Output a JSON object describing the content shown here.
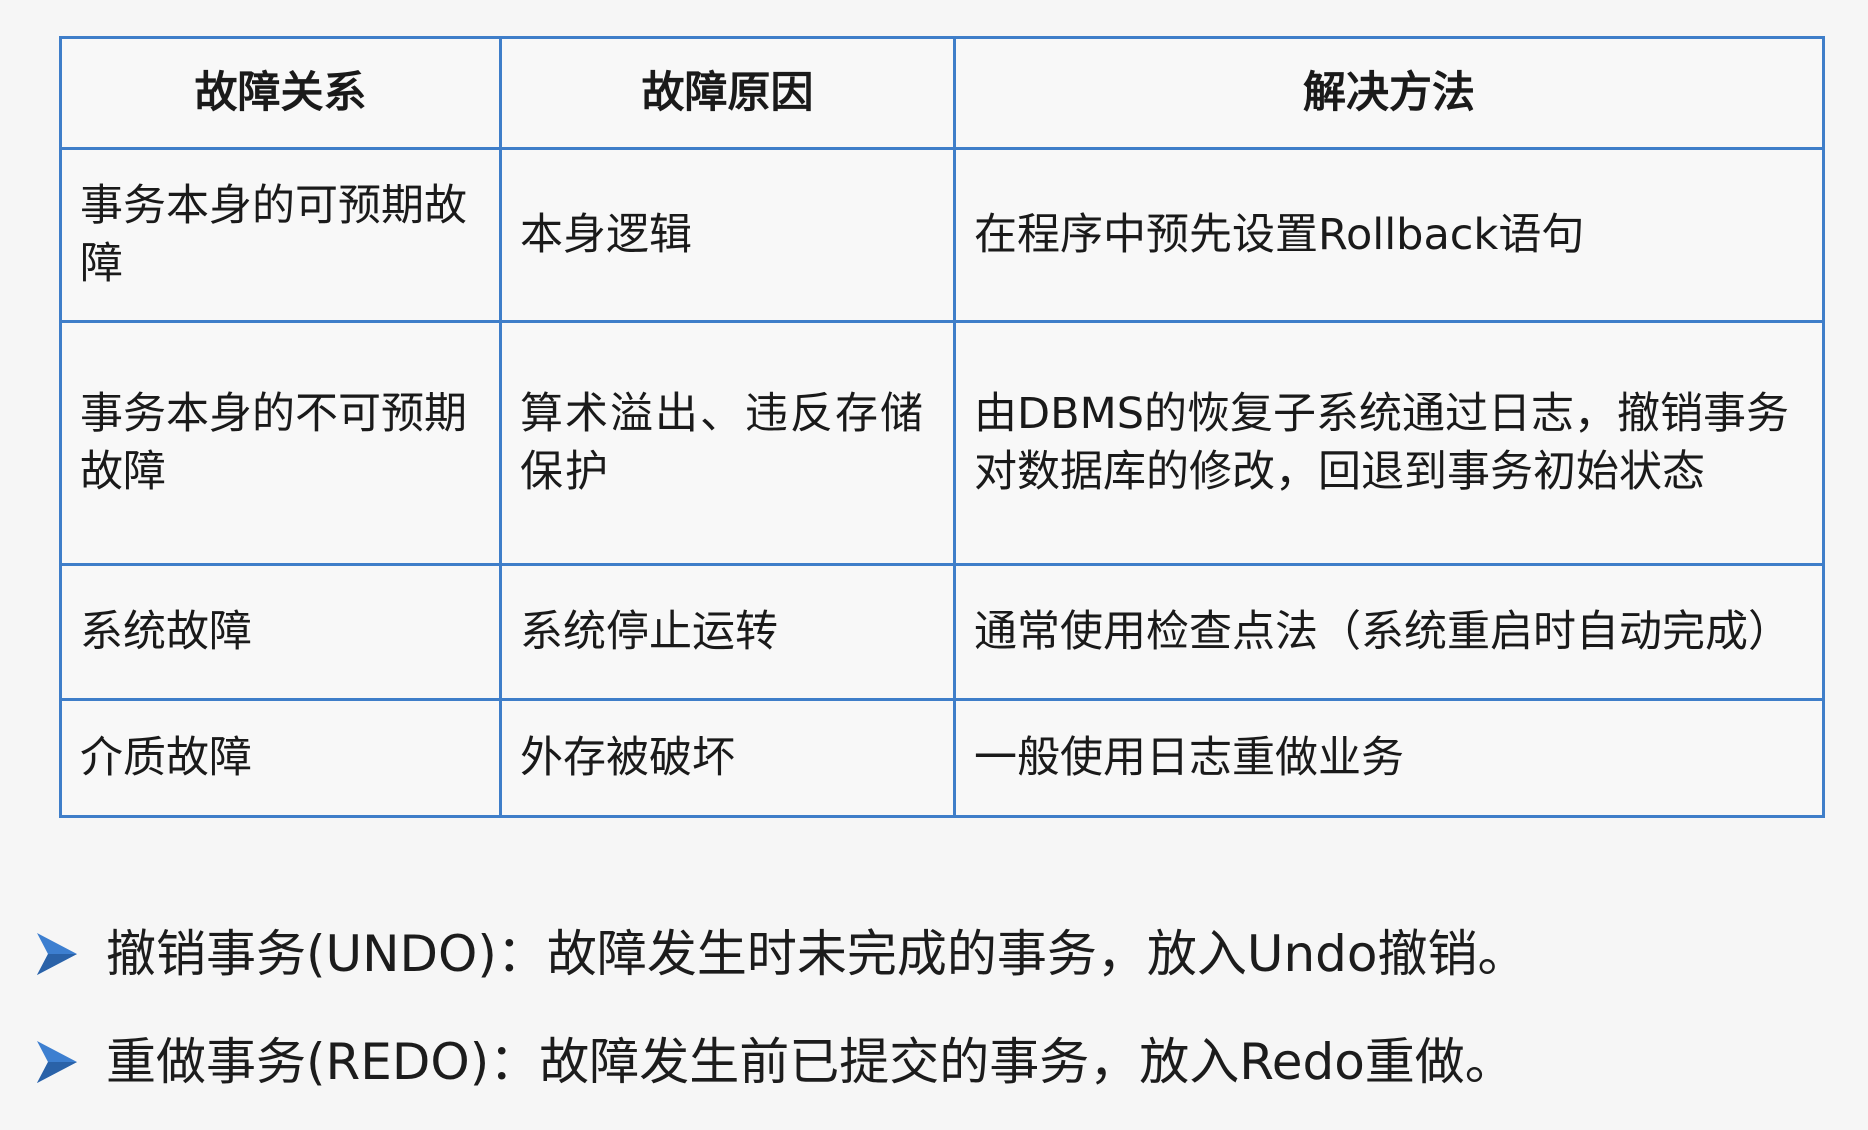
{
  "table": {
    "headers": [
      "故障关系",
      "故障原因",
      "解决方法"
    ],
    "rows": [
      {
        "relation": "事务本身的可预期故障",
        "cause": "本身逻辑",
        "solution": "在程序中预先设置Rollback语句"
      },
      {
        "relation": "事务本身的不可预期故障",
        "cause": "算术溢出、违反存储保护",
        "solution": "由DBMS的恢复子系统通过日志，撤销事务对数据库的修改，回退到事务初始状态"
      },
      {
        "relation": "系统故障",
        "cause": "系统停止运转",
        "solution": "通常使用检查点法（系统重启时自动完成）"
      },
      {
        "relation": "介质故障",
        "cause": "外存被破坏",
        "solution": "一般使用日志重做业务"
      }
    ]
  },
  "bullets": [
    {
      "icon": "arrow-bullet-icon",
      "text": "撤销事务(UNDO)：故障发生时未完成的事务，放入Undo撤销。"
    },
    {
      "icon": "arrow-bullet-icon",
      "text": "重做事务(REDO)：故障发生前已提交的事务，放入Redo重做。"
    }
  ],
  "colors": {
    "table_border": "#3f7ec9",
    "bullet_arrow": "#3d7fd0",
    "background": "#f6f6f6"
  }
}
